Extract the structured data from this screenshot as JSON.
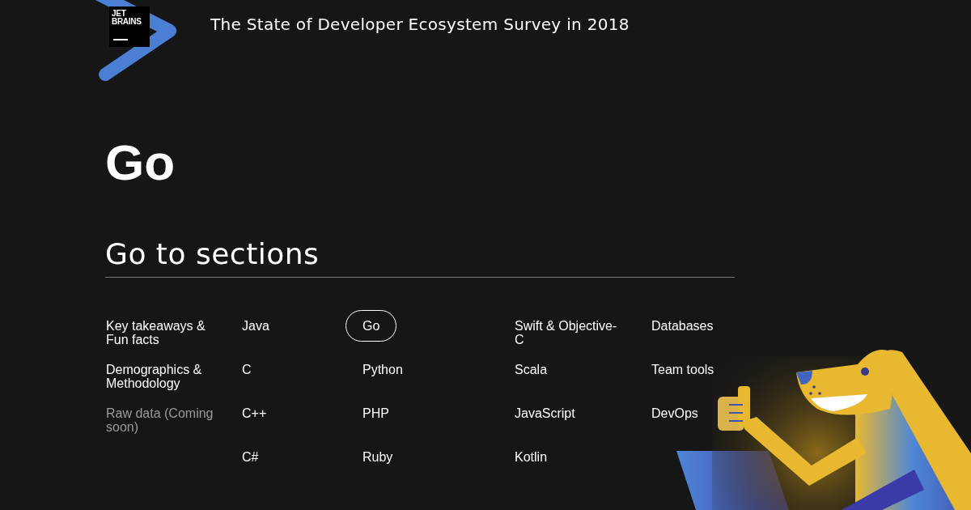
{
  "logo": {
    "lines": [
      "JET",
      "BRAINS"
    ]
  },
  "header": {
    "title": "The State of Developer Ecosystem Survey in 2018"
  },
  "page": {
    "heading": "Go",
    "sections_title": "Go to sections"
  },
  "columns": [
    [
      {
        "label": "Key takeaways & Fun facts",
        "selected": false,
        "disabled": false
      },
      {
        "label": "Demographics & Methodology",
        "selected": false,
        "disabled": false
      },
      {
        "label": "Raw data (Coming soon)",
        "selected": false,
        "disabled": true
      }
    ],
    [
      {
        "label": "Java",
        "selected": false,
        "disabled": false
      },
      {
        "label": "C",
        "selected": false,
        "disabled": false
      },
      {
        "label": "C++",
        "selected": false,
        "disabled": false
      },
      {
        "label": "C#",
        "selected": false,
        "disabled": false
      }
    ],
    [
      {
        "label": "Go",
        "selected": true,
        "disabled": false
      },
      {
        "label": "Python",
        "selected": false,
        "disabled": false
      },
      {
        "label": "PHP",
        "selected": false,
        "disabled": false
      },
      {
        "label": "Ruby",
        "selected": false,
        "disabled": false
      }
    ],
    [
      {
        "label": "Swift & Objective-C",
        "selected": false,
        "disabled": false
      },
      {
        "label": "Scala",
        "selected": false,
        "disabled": false
      },
      {
        "label": "JavaScript",
        "selected": false,
        "disabled": false
      },
      {
        "label": "Kotlin",
        "selected": false,
        "disabled": false
      }
    ],
    [
      {
        "label": "Databases",
        "selected": false,
        "disabled": false
      },
      {
        "label": "Team tools",
        "selected": false,
        "disabled": false
      },
      {
        "label": "DevOps",
        "selected": false,
        "disabled": false
      }
    ]
  ]
}
